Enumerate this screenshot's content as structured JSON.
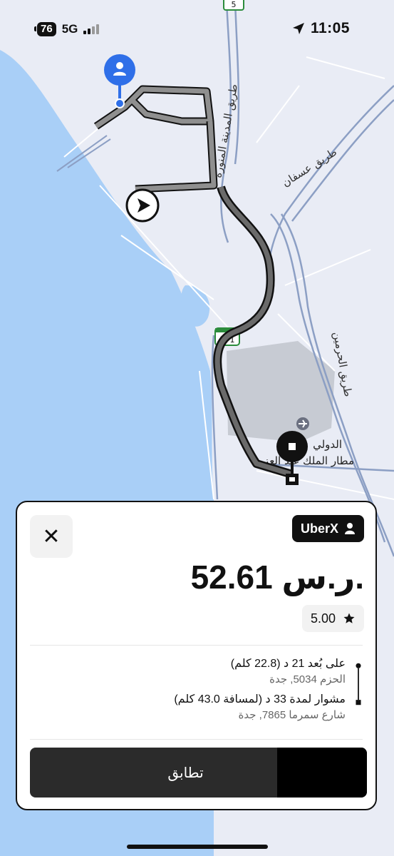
{
  "status_bar": {
    "battery": "76",
    "network": "5G",
    "time": "11:05",
    "icons": [
      "signal-icon",
      "location-arrow-icon"
    ]
  },
  "map": {
    "labels": {
      "road_madinah": "طريق المدينة المنورة",
      "road_usfan": "طريق عسفان",
      "road_haramain": "طريق الحرمين",
      "highway_5": "5",
      "highway_271": "271",
      "airport_line1": "الدولي",
      "airport_line2": "مطار الملك عبد العزيز"
    },
    "colors": {
      "water": "#a9cff7",
      "land": "#e9ecf5",
      "route": "#555555",
      "route_outline": "#111111",
      "pickup": "#2f6fe8"
    },
    "icons": [
      "pickup-person-icon",
      "driver-arrow-icon",
      "destination-square-icon",
      "airport-plane-icon"
    ]
  },
  "ride_card": {
    "close_label": "✕",
    "product": "UberX",
    "price": "52.61 ر.س.",
    "rating": "5.00",
    "pickup": {
      "eta": "على بُعد 21 د (22.8 كلم)",
      "address": "الحزم 5034, جدة"
    },
    "dropoff": {
      "eta": "مشوار لمدة 33 د (لمسافة 43.0 كلم)",
      "address": "شارع سمرما 7865, جدة"
    },
    "action_label": "تطابق"
  }
}
